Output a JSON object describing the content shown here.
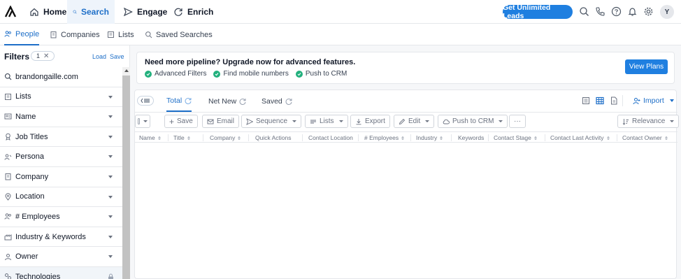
{
  "nav": {
    "tabs": [
      {
        "label": "Home",
        "icon": "home-icon"
      },
      {
        "label": "Search",
        "icon": "search-icon",
        "active": true
      },
      {
        "label": "Engage",
        "icon": "send-icon"
      },
      {
        "label": "Enrich",
        "icon": "refresh-icon"
      }
    ],
    "cta_label": "Get Unlimited Leads",
    "avatar_initial": "Y",
    "accent_color": "#1f7fe0"
  },
  "subnav": {
    "tabs": [
      {
        "label": "People",
        "icon": "people-icon",
        "active": true
      },
      {
        "label": "Companies",
        "icon": "building-icon"
      },
      {
        "label": "Lists",
        "icon": "list-icon"
      },
      {
        "label": "Saved Searches",
        "icon": "saved-search-icon"
      }
    ]
  },
  "filters": {
    "title": "Filters",
    "count": "1",
    "load_label": "Load",
    "save_label": "Save",
    "search_value": "brandongaille.com",
    "items": [
      {
        "label": "Lists",
        "icon": "list-icon"
      },
      {
        "label": "Name",
        "icon": "id-card-icon"
      },
      {
        "label": "Job Titles",
        "icon": "badge-icon"
      },
      {
        "label": "Persona",
        "icon": "persona-icon"
      },
      {
        "label": "Company",
        "icon": "building-icon"
      },
      {
        "label": "Location",
        "icon": "location-pin-icon"
      },
      {
        "label": "# Employees",
        "icon": "people-icon"
      },
      {
        "label": "Industry & Keywords",
        "icon": "industry-icon"
      },
      {
        "label": "Owner",
        "icon": "user-icon"
      },
      {
        "label": "Technologies",
        "icon": "technology-icon"
      }
    ]
  },
  "banner": {
    "title": "Need more pipeline? Upgrade now for advanced features.",
    "features": [
      "Advanced Filters",
      "Find mobile numbers",
      "Push to CRM"
    ],
    "button_label": "View Plans"
  },
  "results": {
    "tabs": [
      {
        "label": "Total",
        "active": true
      },
      {
        "label": "Net New"
      },
      {
        "label": "Saved"
      }
    ],
    "import_label": "Import",
    "toolbar": {
      "save": "Save",
      "email": "Email",
      "sequence": "Sequence",
      "lists": "Lists",
      "export": "Export",
      "edit": "Edit",
      "push": "Push to CRM",
      "more": "···",
      "sort": "Relevance"
    },
    "columns": [
      "Name",
      "Title",
      "Company",
      "Quick Actions",
      "Contact Location",
      "# Employees",
      "Industry",
      "Keywords",
      "Contact Stage",
      "Contact Last Activity",
      "Contact Owner"
    ]
  }
}
